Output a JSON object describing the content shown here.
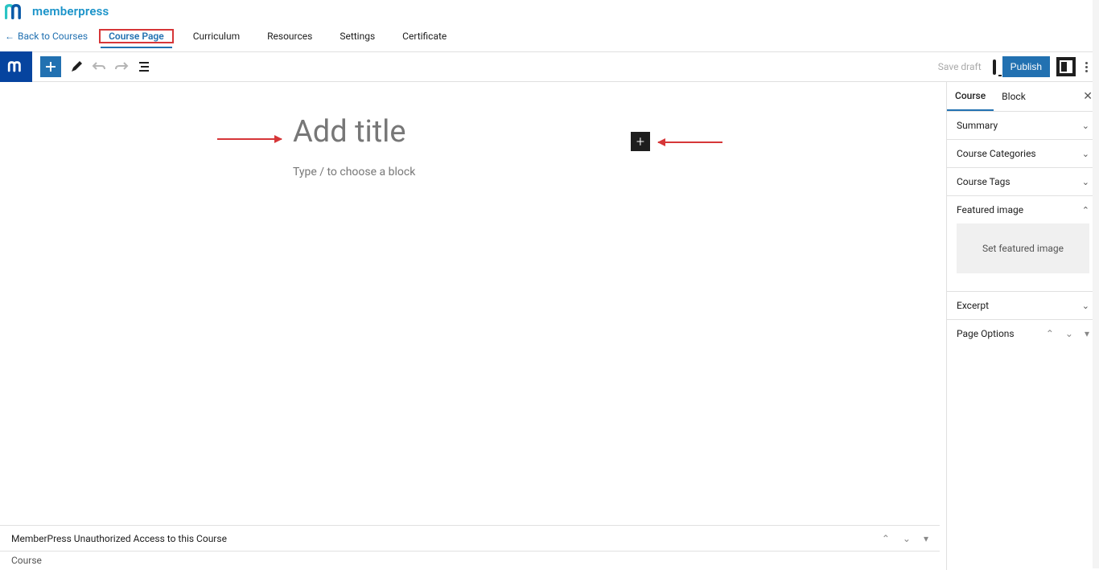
{
  "brand": {
    "name": "memberpress"
  },
  "back": {
    "label": "Back to Courses"
  },
  "tabs": {
    "items": [
      {
        "label": "Course Page"
      },
      {
        "label": "Curriculum"
      },
      {
        "label": "Resources"
      },
      {
        "label": "Settings"
      },
      {
        "label": "Certificate"
      }
    ],
    "active_index": 0
  },
  "toolbar": {
    "save_draft": "Save draft",
    "publish": "Publish"
  },
  "editor": {
    "title_placeholder": "Add title",
    "block_placeholder": "Type / to choose a block"
  },
  "sidebar": {
    "tabs": {
      "course": "Course",
      "block": "Block"
    },
    "panels": {
      "summary": "Summary",
      "categories": "Course Categories",
      "tags": "Course Tags",
      "featured": "Featured image",
      "featured_button": "Set featured image",
      "excerpt": "Excerpt",
      "page_options": "Page Options"
    }
  },
  "footer": {
    "meta_title": "MemberPress Unauthorized Access to this Course",
    "breadcrumb": "Course"
  },
  "colors": {
    "accent": "#2271b1",
    "brand_dark": "#06449f",
    "brand_teal": "#2ac4c4",
    "danger": "#d63638"
  }
}
